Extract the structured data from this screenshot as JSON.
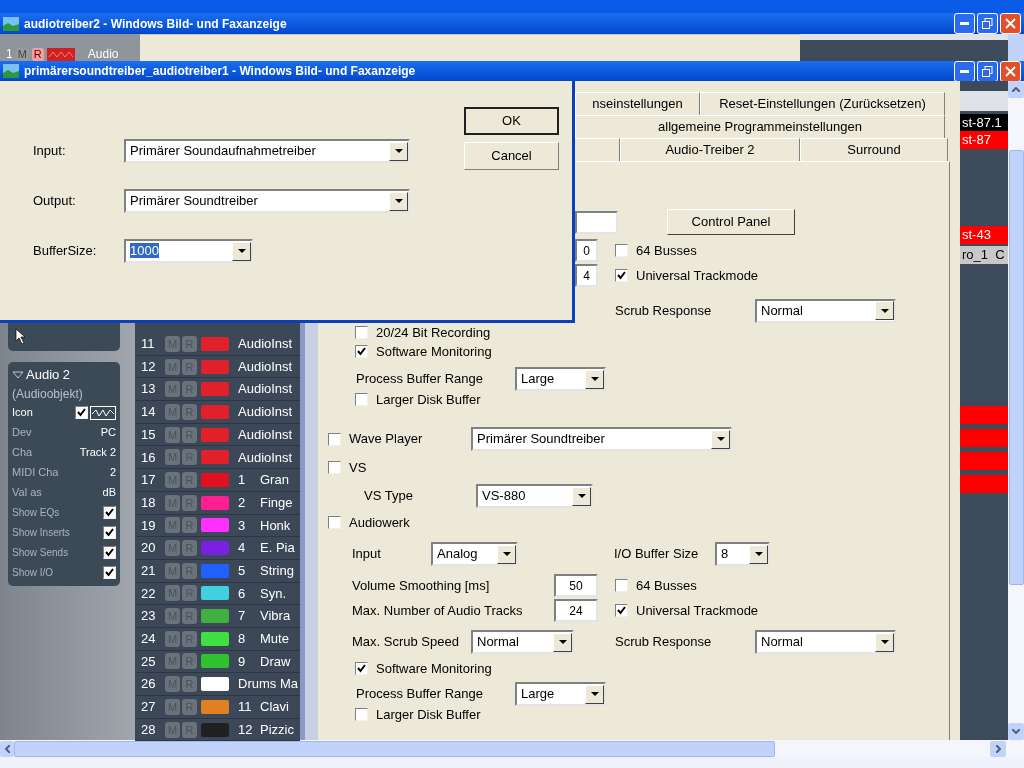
{
  "back_window": {
    "title": "audiotreiber2 - Windows Bild- und Faxanzeige",
    "track": {
      "number": "1",
      "mute": "M",
      "record": "R",
      "name": "Audio"
    }
  },
  "window": {
    "title": "primärersoundtreiber_audiotreiber1 - Windows Bild- und Faxanzeige"
  },
  "driver_dialog": {
    "fields": [
      {
        "label": "Input:",
        "value": "Primärer Soundaufnahmetreiber",
        "kind": "dropdown"
      },
      {
        "label": "Output:",
        "value": "Primärer Soundtreiber",
        "kind": "dropdown"
      },
      {
        "label": "BufferSize:",
        "value": "1000",
        "kind": "combo"
      }
    ],
    "buttons": [
      {
        "label": "OK",
        "default": true
      },
      {
        "label": "Cancel",
        "default": false
      }
    ]
  },
  "inspector": {
    "title": "Audio 2",
    "subtitle": "(Audioobjekt)",
    "icon_label": "Icon",
    "icon_checked": true,
    "properties": [
      {
        "label": "Dev",
        "value": "PC"
      },
      {
        "label": "Cha",
        "value": "Track 2"
      },
      {
        "label": "MIDI Cha",
        "value": "2"
      },
      {
        "label": "Val as",
        "value": "dB"
      }
    ],
    "toggles": [
      {
        "label": "Show EQs",
        "checked": true
      },
      {
        "label": "Show Inserts",
        "checked": true
      },
      {
        "label": "Show Sends",
        "checked": true
      },
      {
        "label": "Show I/O",
        "checked": true
      }
    ]
  },
  "tracks": [
    {
      "number": "11",
      "mute": "M",
      "record": "R",
      "color": "#e0202a",
      "name": "AudioInst"
    },
    {
      "number": "12",
      "mute": "M",
      "record": "R",
      "color": "#e0202a",
      "name": "AudioInst"
    },
    {
      "number": "13",
      "mute": "M",
      "record": "R",
      "color": "#e0202a",
      "name": "AudioInst"
    },
    {
      "number": "14",
      "mute": "M",
      "record": "R",
      "color": "#e0202a",
      "name": "AudioInst"
    },
    {
      "number": "15",
      "mute": "M",
      "record": "R",
      "color": "#e0202a",
      "name": "AudioInst"
    },
    {
      "number": "16",
      "mute": "M",
      "record": "R",
      "color": "#e0202a",
      "name": "AudioInst"
    },
    {
      "number": "17",
      "mute": "M",
      "record": "R",
      "color": "#e01020",
      "index": "1",
      "name": "Gran"
    },
    {
      "number": "18",
      "mute": "M",
      "record": "R",
      "color": "#ff2090",
      "index": "2",
      "name": "Finge"
    },
    {
      "number": "19",
      "mute": "M",
      "record": "R",
      "color": "#ff30ff",
      "index": "3",
      "name": "Honk"
    },
    {
      "number": "20",
      "mute": "M",
      "record": "R",
      "color": "#7a20e0",
      "index": "4",
      "name": "E. Pia"
    },
    {
      "number": "21",
      "mute": "M",
      "record": "R",
      "color": "#2060ff",
      "index": "5",
      "name": "String"
    },
    {
      "number": "22",
      "mute": "M",
      "record": "R",
      "color": "#40d0e0",
      "index": "6",
      "name": "Syn."
    },
    {
      "number": "23",
      "mute": "M",
      "record": "R",
      "color": "#40b040",
      "index": "7",
      "name": "Vibra"
    },
    {
      "number": "24",
      "mute": "M",
      "record": "R",
      "color": "#40e040",
      "index": "8",
      "name": "Mute"
    },
    {
      "number": "25",
      "mute": "M",
      "record": "R",
      "color": "#30c030",
      "index": "9",
      "name": "Draw"
    },
    {
      "number": "26",
      "mute": "M",
      "record": "R",
      "color": "#ffffff",
      "name": "Drums Ma"
    },
    {
      "number": "27",
      "mute": "M",
      "record": "R",
      "color": "#e08020",
      "index": "11",
      "name": "Clavi"
    },
    {
      "number": "28",
      "mute": "M",
      "record": "R",
      "color": "#202020",
      "index": "12",
      "name": "Pizzic"
    }
  ],
  "settings": {
    "tab_rows": [
      [
        {
          "label": "nseinstellungen",
          "selected": false
        },
        {
          "label": "Reset-Einstellungen (Zurücksetzen)",
          "selected": false
        }
      ],
      [
        {
          "label": "allgemeine Programmeinstellungen",
          "selected": false
        }
      ],
      [
        {
          "label": "Audio-Treiber 2",
          "selected": false
        },
        {
          "label": "Surround",
          "selected": false
        }
      ]
    ],
    "control_panel_button": "Control Panel",
    "upper": {
      "values": [
        "0",
        "4"
      ],
      "busses": {
        "label": "64 Busses",
        "checked": false
      },
      "trackmode": {
        "label": "Universal Trackmode",
        "checked": true
      },
      "scrub_response": {
        "label": "Scrub Response",
        "value": "Normal"
      },
      "options": [
        {
          "label": "20/24 Bit Recording",
          "checked": false
        },
        {
          "label": "Software Monitoring",
          "checked": true
        }
      ],
      "buffer_range": {
        "label": "Process Buffer Range",
        "value": "Large"
      },
      "disk": {
        "label": "Larger Disk Buffer",
        "checked": false
      }
    },
    "wave_player": {
      "label": "Wave Player",
      "checked": false,
      "value": "Primärer Soundtreiber"
    },
    "vs": {
      "label": "VS",
      "checked": false,
      "type_label": "VS Type",
      "type_value": "VS-880"
    },
    "audiowerk": {
      "label": "Audiowerk",
      "checked": false,
      "input_label": "Input",
      "input_value": "Analog",
      "io_label": "I/O Buffer Size",
      "io_value": "8",
      "smoothing_label": "Volume Smoothing [ms]",
      "smoothing_value": "50",
      "busses": {
        "label": "64 Busses",
        "checked": false
      },
      "tracks_label": "Max. Number of Audio Tracks",
      "tracks_value": "24",
      "trackmode": {
        "label": "Universal Trackmode",
        "checked": true
      },
      "scrub_speed_label": "Max. Scrub Speed",
      "scrub_speed_value": "Normal",
      "scrub_response": {
        "label": "Scrub Response",
        "value": "Normal"
      },
      "monitoring": {
        "label": "Software Monitoring",
        "checked": true
      },
      "buffer_range": {
        "label": "Process Buffer Range",
        "value": "Large"
      },
      "disk": {
        "label": "Larger Disk Buffer",
        "checked": false
      }
    }
  },
  "arrange": {
    "clips": [
      {
        "label": "st-87.1",
        "color": "#000000"
      },
      {
        "label": "st-87",
        "color": "#ff0000"
      },
      {
        "label": "st-43",
        "color": "#ff0000"
      },
      {
        "label": "ro_1  C",
        "color": "#c8c8c8"
      },
      {
        "color": "#ff0000"
      },
      {
        "color": "#ff0000"
      },
      {
        "color": "#ff0000"
      },
      {
        "color": "#ff0000"
      }
    ]
  }
}
